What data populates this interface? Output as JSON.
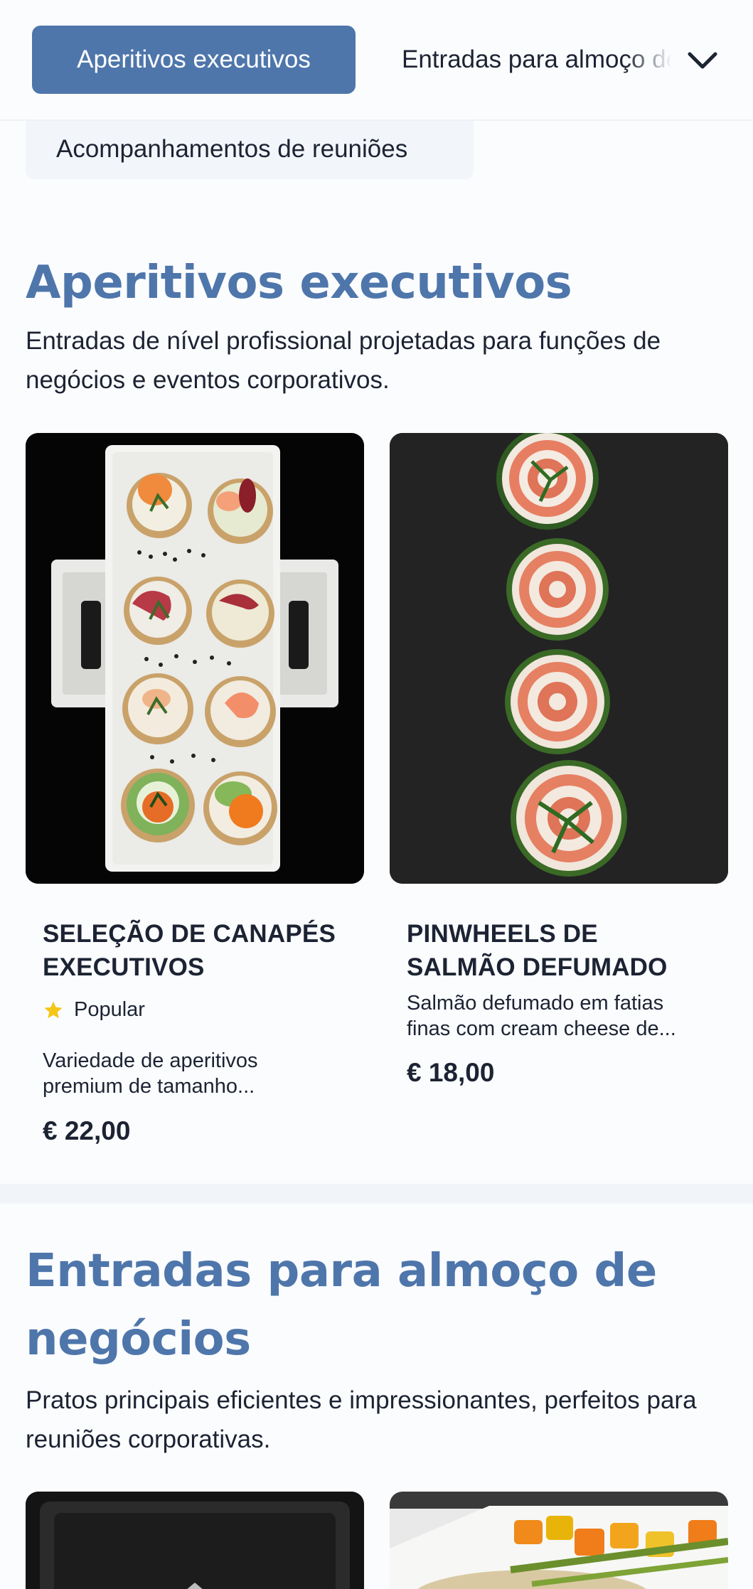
{
  "nav": {
    "active_tab": "Aperitivos executivos",
    "next_tab": "Entradas para almoço de negócios",
    "third_tab": "Acompanhamentos de reuniões"
  },
  "section1": {
    "title": "Aperitivos executivos",
    "description": "Entradas de nível profissional projetadas para funções de negócios e eventos corporativos.",
    "cards": [
      {
        "name": "SELEÇÃO DE CANAPÉS EXECUTIVOS",
        "badge": "Popular",
        "description": "Variedade de aperitivos premium de tamanho...",
        "price": "€ 22,00"
      },
      {
        "name": "PINWHEELS DE SALMÃO DEFUMADO",
        "description": "Salmão defumado em fatias finas com cream cheese de...",
        "price": "€ 18,00"
      }
    ]
  },
  "section2": {
    "title": "Entradas para almoço de negócios",
    "description": "Pratos principais eficientes e impressionantes, perfeitos para reuniões corporativas."
  },
  "icons": {
    "dropdown": "chevron-down-icon",
    "badge": "star-icon"
  },
  "colors": {
    "accent": "#4e76ab",
    "text": "#1c2333",
    "star": "#f5c518",
    "background": "#fbfcfe"
  }
}
